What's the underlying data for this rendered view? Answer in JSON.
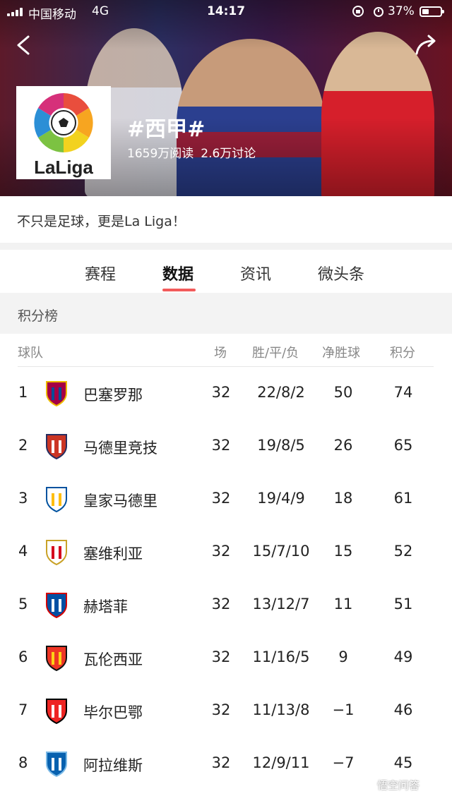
{
  "status_bar": {
    "carrier": "中国移动",
    "network": "4G",
    "time": "14:17",
    "battery": "37%",
    "battery_level": 0.37
  },
  "header": {
    "tag_title": "#西甲#",
    "reads": "1659万阅读",
    "discussions": "2.6万讨论",
    "logo_text": "LaLiga"
  },
  "description": "不只是足球，更是La Liga！",
  "tabs": [
    {
      "label": "赛程",
      "active": false
    },
    {
      "label": "数据",
      "active": true
    },
    {
      "label": "资讯",
      "active": false
    },
    {
      "label": "微头条",
      "active": false
    }
  ],
  "section_title": "积分榜",
  "table": {
    "headers": {
      "team": "球队",
      "played": "场",
      "wdl": "胜/平/负",
      "gd": "净胜球",
      "points": "积分"
    },
    "rows": [
      {
        "rank": "1",
        "team": "巴塞罗那",
        "played": "32",
        "wdl": "22/8/2",
        "gd": "50",
        "points": "74",
        "badge": "barcelona-badge-icon"
      },
      {
        "rank": "2",
        "team": "马德里竞技",
        "played": "32",
        "wdl": "19/8/5",
        "gd": "26",
        "points": "65",
        "badge": "atletico-badge-icon"
      },
      {
        "rank": "3",
        "team": "皇家马德里",
        "played": "32",
        "wdl": "19/4/9",
        "gd": "18",
        "points": "61",
        "badge": "real-madrid-badge-icon"
      },
      {
        "rank": "4",
        "team": "塞维利亚",
        "played": "32",
        "wdl": "15/7/10",
        "gd": "15",
        "points": "52",
        "badge": "sevilla-badge-icon"
      },
      {
        "rank": "5",
        "team": "赫塔菲",
        "played": "32",
        "wdl": "13/12/7",
        "gd": "11",
        "points": "51",
        "badge": "getafe-badge-icon"
      },
      {
        "rank": "6",
        "team": "瓦伦西亚",
        "played": "32",
        "wdl": "11/16/5",
        "gd": "9",
        "points": "49",
        "badge": "valencia-badge-icon"
      },
      {
        "rank": "7",
        "team": "毕尔巴鄂",
        "played": "32",
        "wdl": "11/13/8",
        "gd": "−1",
        "points": "46",
        "badge": "bilbao-badge-icon"
      },
      {
        "rank": "8",
        "team": "阿拉维斯",
        "played": "32",
        "wdl": "12/9/11",
        "gd": "−7",
        "points": "45",
        "badge": "alaves-badge-icon"
      }
    ]
  },
  "watermark": "悟空问答",
  "colors": {
    "accent": "#f25a5a",
    "section_bg": "#f3f3f3"
  }
}
